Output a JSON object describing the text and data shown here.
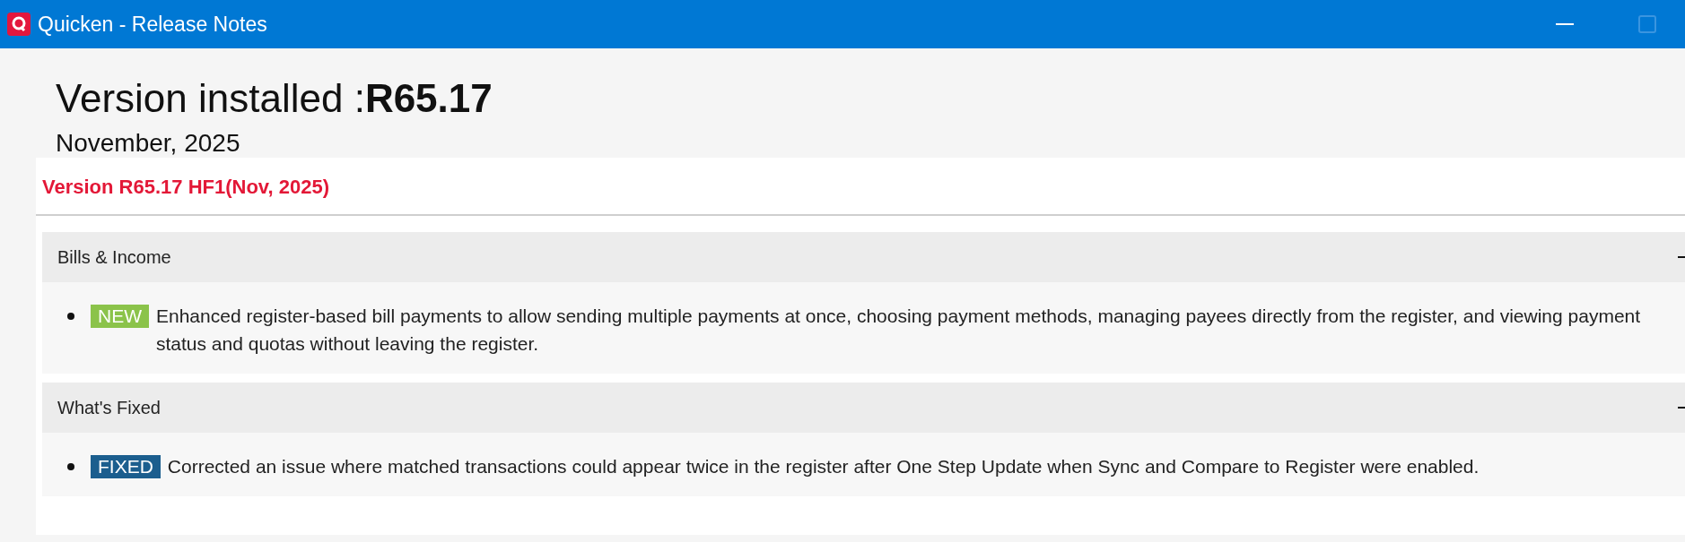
{
  "window": {
    "title": "Quicken - Release Notes"
  },
  "heading": {
    "label": "Version installed :",
    "version": "R65.17"
  },
  "date": "November, 2025",
  "release": {
    "title": "Version R65.17 HF1(Nov, 2025)",
    "sections": [
      {
        "title": "Bills & Income",
        "expanded": true,
        "items": [
          {
            "kind": "new",
            "badge": "NEW",
            "text": "Enhanced register-based bill payments to allow sending multiple payments at once, choosing payment methods, managing payees directly from the register, and viewing payment status and quotas without leaving the register."
          }
        ]
      },
      {
        "title": "What's Fixed",
        "expanded": true,
        "items": [
          {
            "kind": "fixed",
            "badge": "FIXED",
            "text": "Corrected an issue where matched transactions could appear twice in the register after One Step Update when Sync and Compare to Register were enabled."
          }
        ]
      }
    ]
  }
}
